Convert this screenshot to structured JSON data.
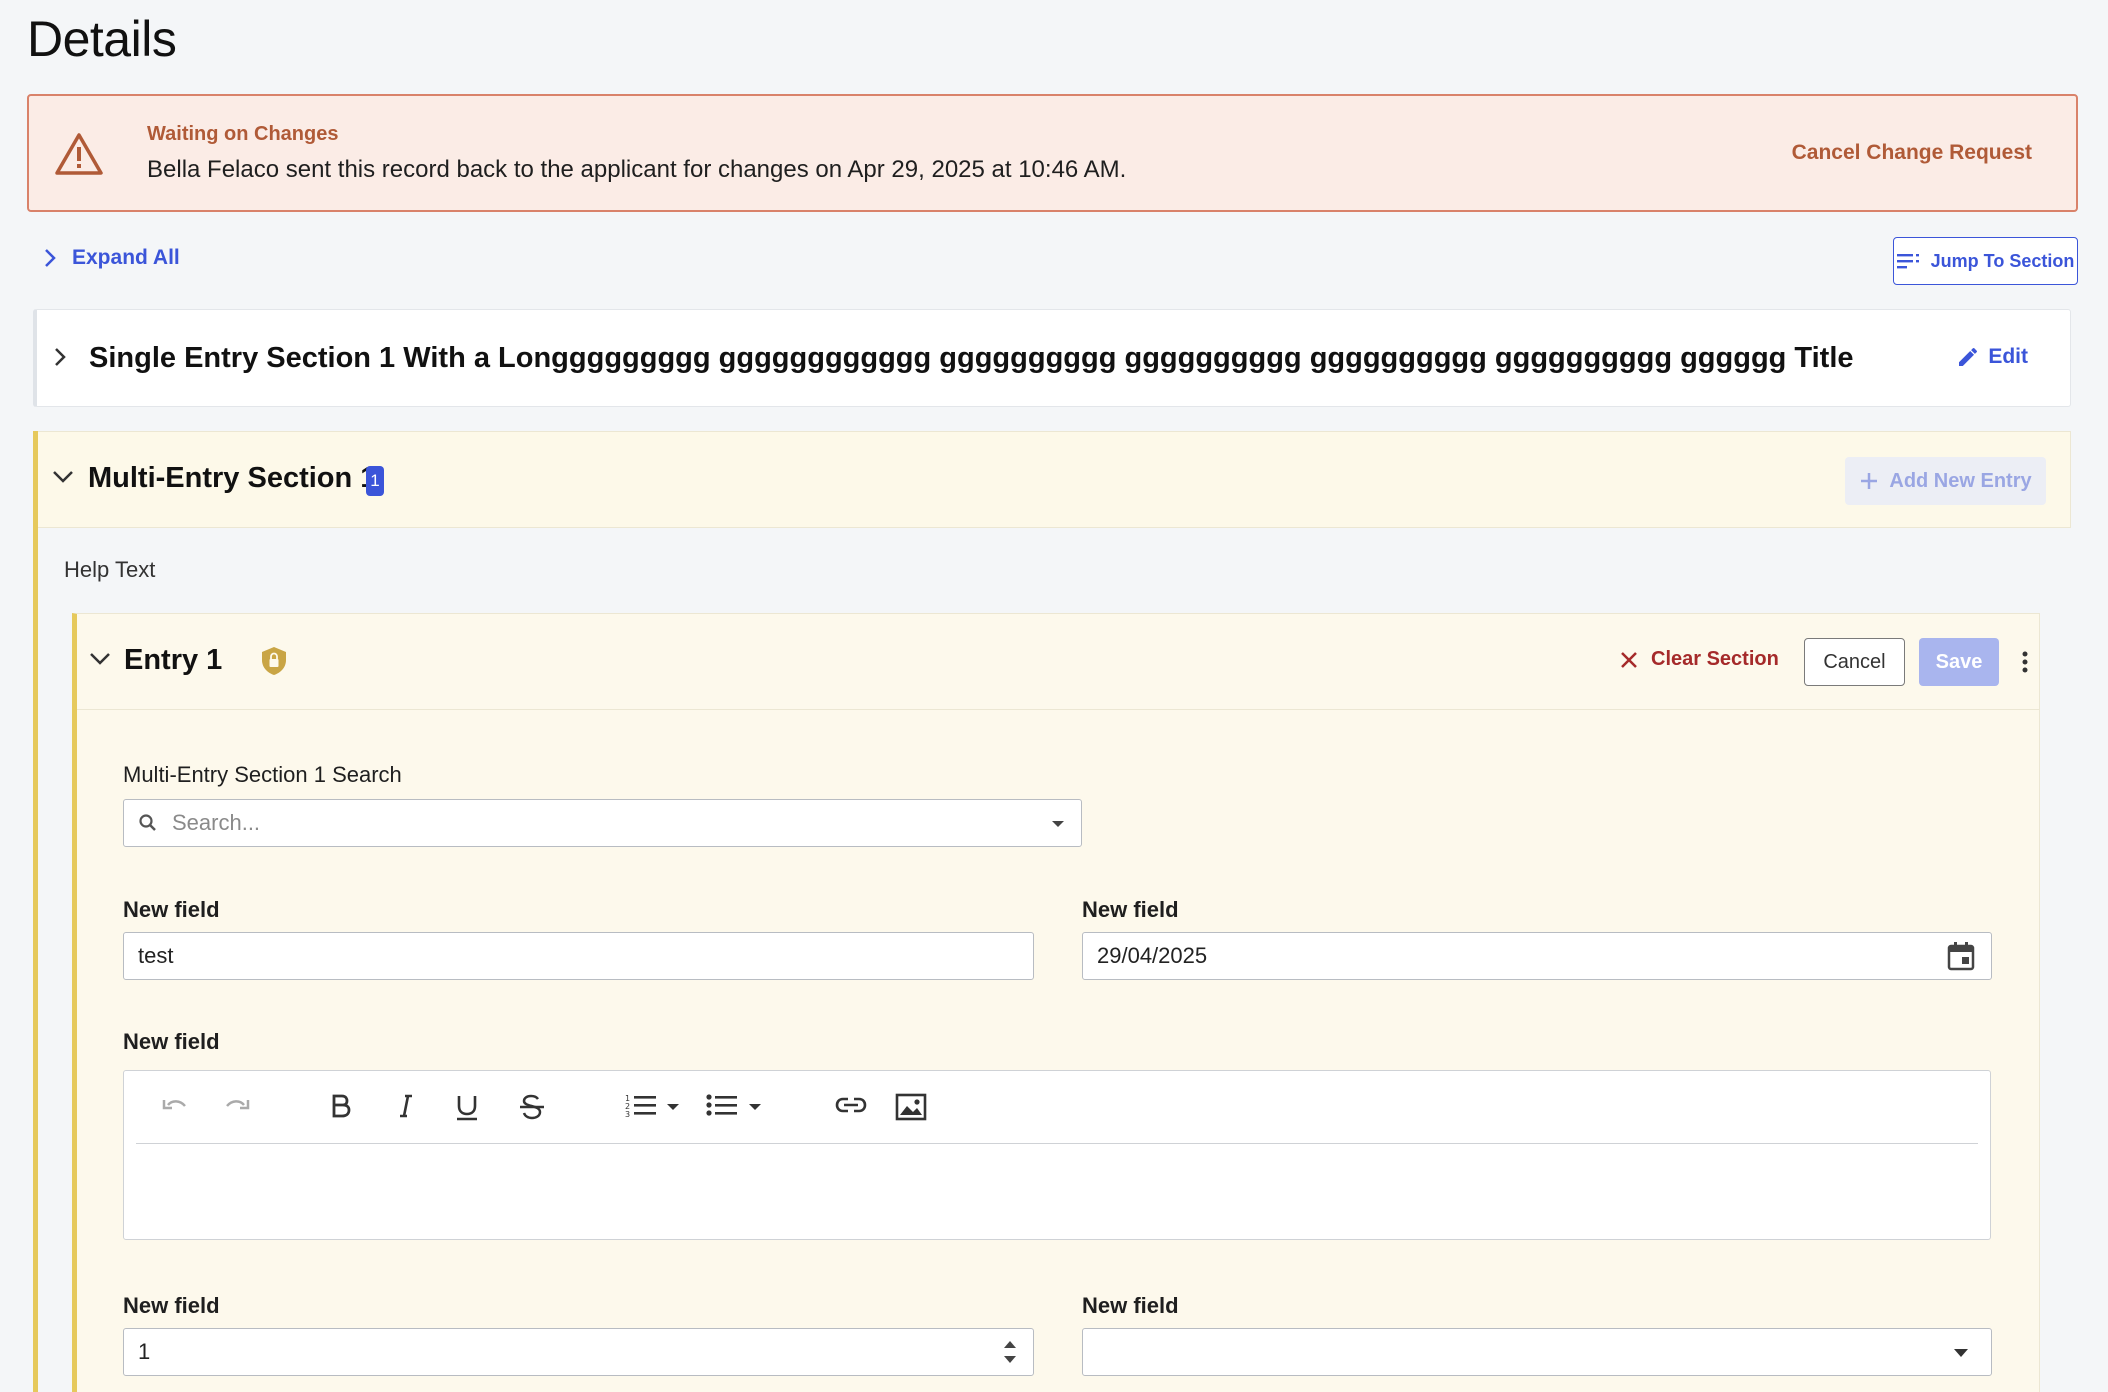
{
  "page": {
    "title": "Details"
  },
  "alert": {
    "title": "Waiting on Changes",
    "message": "Bella Felaco sent this record back to the applicant for changes on Apr 29, 2025 at 10:46 AM.",
    "action": "Cancel Change Request",
    "icon": "warning-triangle-icon"
  },
  "controls": {
    "expand_all": "Expand All",
    "jump_to_section": "Jump To Section"
  },
  "single_section": {
    "title": "Single Entry Section 1 With a Longgggggggg gggggggggggg gggggggggg gggggggggg gggggggggg gggggggggg gggggg Title",
    "edit_label": "Edit"
  },
  "multi_section": {
    "title": "Multi-Entry Section 1",
    "count": "1",
    "add_label": "Add New Entry",
    "help_text": "Help Text",
    "entry": {
      "title": "Entry 1",
      "clear_label": "Clear Section",
      "cancel_label": "Cancel",
      "save_label": "Save",
      "search": {
        "label": "Multi-Entry Section 1 Search",
        "placeholder": "Search..."
      },
      "fields": [
        {
          "label": "New field",
          "value": "test"
        },
        {
          "label": "New field",
          "value": "29/04/2025"
        },
        {
          "label": "New field",
          "value": ""
        },
        {
          "label": "New field",
          "value": "1"
        },
        {
          "label": "New field",
          "value": ""
        }
      ]
    }
  },
  "colors": {
    "accent": "#3b55d9",
    "alert_bg": "#fbece6",
    "alert_border": "#d9826a",
    "alert_text": "#b05a37",
    "section_accent": "#e6c95c",
    "danger": "#a52a2a"
  }
}
